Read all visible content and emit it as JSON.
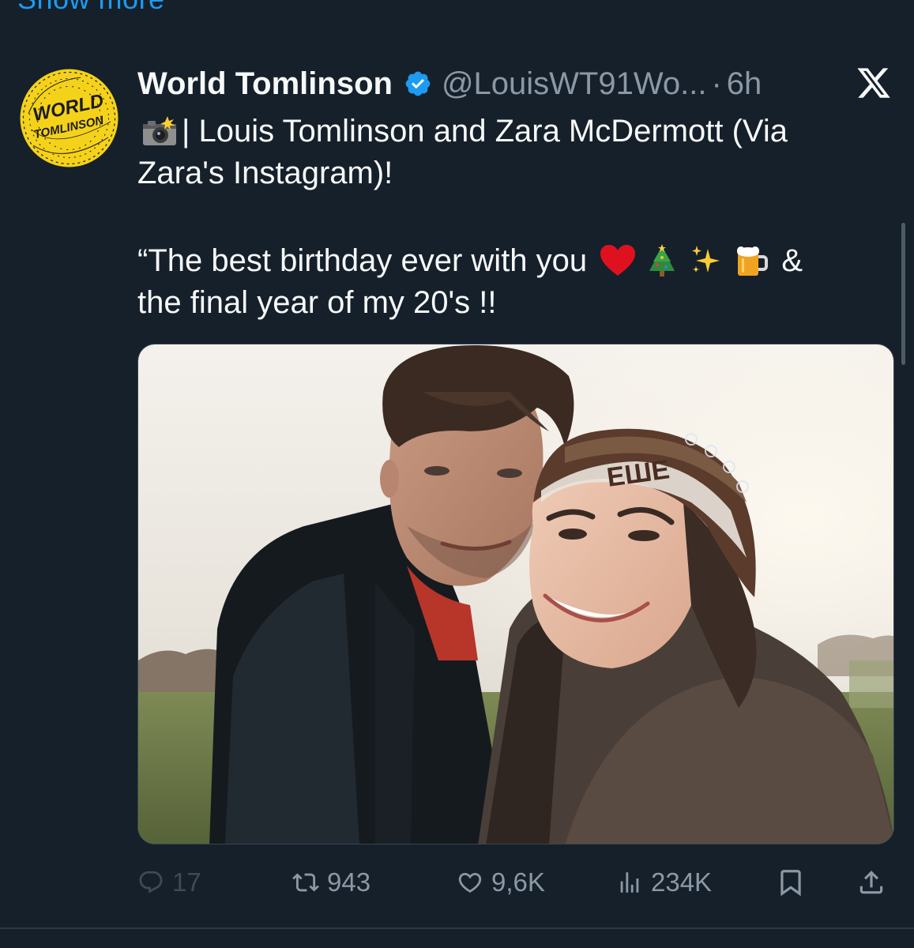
{
  "top": {
    "show_more_label": "Show more"
  },
  "tweet": {
    "display_name": "World Tomlinson",
    "handle": "@LouisWT91Wo...",
    "separator": "·",
    "time": "6h",
    "avatar_text": {
      "line1": "WORLD",
      "line2": "TOMLINSON"
    },
    "text": {
      "line1": "| Louis Tomlinson and Zara McDermott (Via Zara's Instagram)!",
      "quote_start": "“The best birthday ever with you",
      "quote_amp": "&",
      "quote_end": "the final year of my 20's !!"
    },
    "emojis": [
      "camera-flash-emoji",
      "red-heart-emoji",
      "christmas-tree-emoji",
      "sparkles-emoji",
      "beer-mug-emoji"
    ]
  },
  "actions": {
    "reply_count": "17",
    "retweet_count": "943",
    "like_count": "9,6K",
    "views_count": "234K"
  },
  "colors": {
    "background": "#15202b",
    "text_primary": "#f7f9f9",
    "text_secondary": "#8b98a5",
    "accent": "#1d9bf0",
    "avatar_yellow": "#f5d21a"
  },
  "icons": {
    "verified": "verified-badge-icon",
    "platform": "x-logo-icon",
    "reply": "reply-icon",
    "retweet": "retweet-icon",
    "like": "heart-icon",
    "views": "views-icon",
    "bookmark": "bookmark-icon",
    "share": "share-icon"
  }
}
